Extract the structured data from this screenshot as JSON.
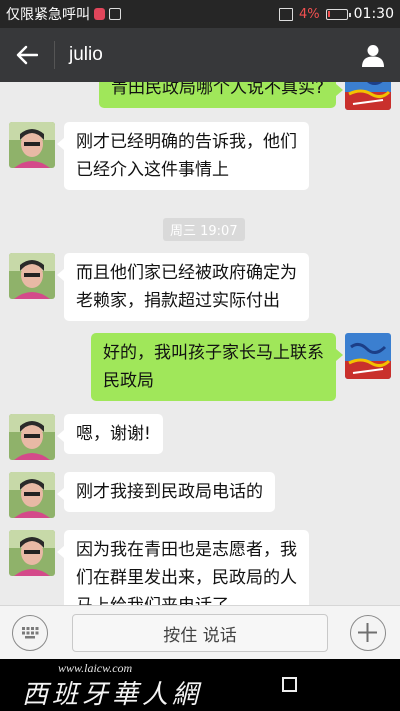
{
  "status_bar": {
    "carrier_text": "仅限紧急呼叫",
    "battery_percent": "4%",
    "time": "01:30"
  },
  "header": {
    "back_icon": "arrow-left-icon",
    "title": "julio",
    "profile_icon": "person-icon"
  },
  "messages": [
    {
      "sender": "me",
      "text_lines": [
        "青田民政局哪个人说不真实?"
      ]
    },
    {
      "sender": "julio",
      "text_lines": [
        "刚才已经明确的告诉我，他们",
        "已经介入这件事情上"
      ]
    },
    {
      "type": "time",
      "text": "周三 19:07"
    },
    {
      "sender": "julio",
      "text_lines": [
        "而且他们家已经被政府确定为",
        "老赖家，捐款超过实际付出"
      ]
    },
    {
      "sender": "me",
      "text_lines": [
        "好的，我叫孩子家长马上联系",
        "民政局"
      ]
    },
    {
      "sender": "julio",
      "text_lines": [
        "嗯，谢谢!"
      ]
    },
    {
      "sender": "julio",
      "text_lines": [
        "刚才我接到民政局电话的"
      ]
    },
    {
      "sender": "julio",
      "text_lines": [
        "因为我在青田也是志愿者，我",
        "们在群里发出来，民政局的人",
        "马上给我们来电话了"
      ]
    }
  ],
  "input_bar": {
    "keyboard_icon": "keyboard-icon",
    "hold_to_talk": "按住 说话",
    "plus_icon": "plus-icon"
  },
  "watermark": {
    "url": "www.laicw.com",
    "logo_text": "西班牙華人網"
  },
  "colors": {
    "header_bg": "#37383a",
    "bubble_out": "#a0e75a",
    "bubble_in": "#ffffff",
    "chat_bg": "#ebebeb",
    "battery_low": "#f25050"
  }
}
